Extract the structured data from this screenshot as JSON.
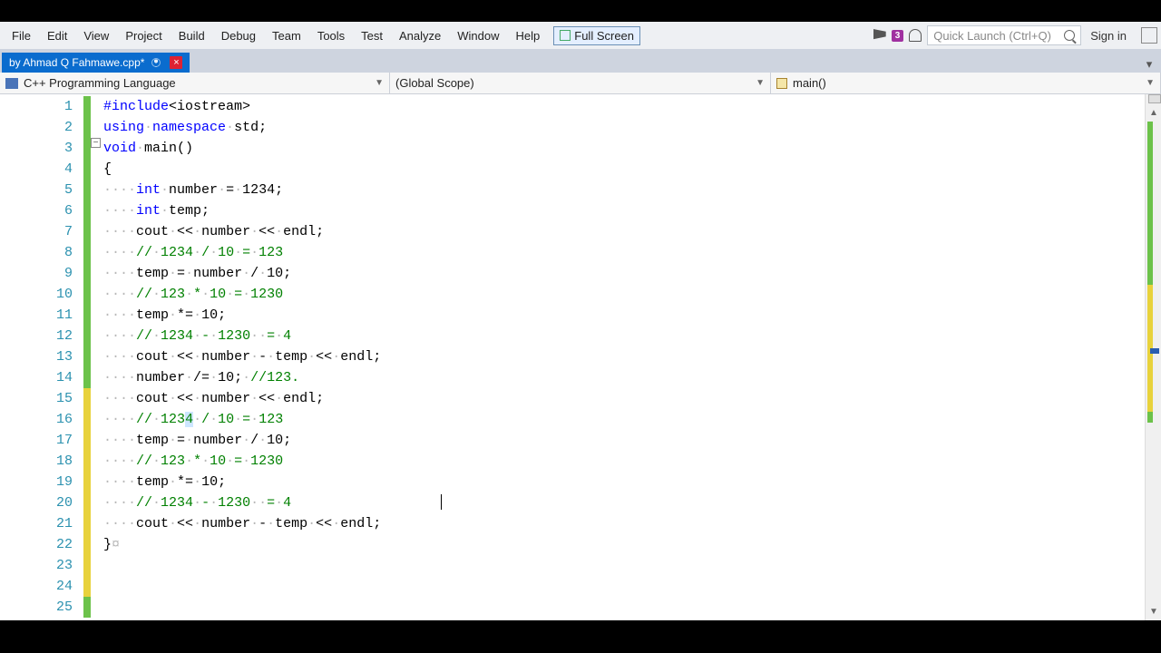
{
  "menu": {
    "items": [
      "File",
      "Edit",
      "View",
      "Project",
      "Build",
      "Debug",
      "Team",
      "Tools",
      "Test",
      "Analyze",
      "Window",
      "Help"
    ],
    "fullscreen": "Full Screen",
    "notif_count": "3",
    "search_placeholder": "Quick Launch (Ctrl+Q)",
    "signin": "Sign in"
  },
  "tab": {
    "title": "by Ahmad Q Fahmawe.cpp*"
  },
  "context": {
    "lang": "C++ Programming Language",
    "scope": "(Global Scope)",
    "func": "main()"
  },
  "code": {
    "lines": [
      {
        "n": "1",
        "bar": "green",
        "html": "<span class='kw'>#include</span>&lt;iostream&gt;"
      },
      {
        "n": "2",
        "bar": "green",
        "html": "<span class='kw'>using</span><span class='ws'>·</span><span class='kw'>namespace</span><span class='ws'>·</span>std;"
      },
      {
        "n": "3",
        "bar": "green",
        "html": "<span class='kw'>void</span><span class='ws'>·</span>main()"
      },
      {
        "n": "4",
        "bar": "green",
        "html": "{"
      },
      {
        "n": "5",
        "bar": "green",
        "html": ""
      },
      {
        "n": "6",
        "bar": "green",
        "html": "<span class='ws'>····</span><span class='kw'>int</span><span class='ws'>·</span>number<span class='ws'>·</span>=<span class='ws'>·</span>1234;"
      },
      {
        "n": "7",
        "bar": "green",
        "html": "<span class='ws'>····</span><span class='kw'>int</span><span class='ws'>·</span>temp;"
      },
      {
        "n": "8",
        "bar": "green",
        "html": "<span class='ws'>····</span>cout<span class='ws'>·</span>&lt;&lt;<span class='ws'>·</span>number<span class='ws'>·</span>&lt;&lt;<span class='ws'>·</span>endl;"
      },
      {
        "n": "9",
        "bar": "green",
        "html": "<span class='ws'>····</span><span class='cm'>//<span class='ws'>·</span>1234<span class='ws'>·</span>/<span class='ws'>·</span>10<span class='ws'>·</span>=<span class='ws'>·</span>123</span>"
      },
      {
        "n": "10",
        "bar": "green",
        "html": "<span class='ws'>····</span>temp<span class='ws'>·</span>=<span class='ws'>·</span>number<span class='ws'>·</span>/<span class='ws'>·</span>10;"
      },
      {
        "n": "11",
        "bar": "green",
        "html": "<span class='ws'>····</span><span class='cm'>//<span class='ws'>·</span>123<span class='ws'>·</span>*<span class='ws'>·</span>10<span class='ws'>·</span>=<span class='ws'>·</span>1230</span>"
      },
      {
        "n": "12",
        "bar": "green",
        "html": "<span class='ws'>····</span>temp<span class='ws'>·</span>*=<span class='ws'>·</span>10;"
      },
      {
        "n": "13",
        "bar": "green",
        "html": "<span class='ws'>····</span><span class='cm'>//<span class='ws'>·</span>1234<span class='ws'>·</span>-<span class='ws'>·</span>1230<span class='ws'>··</span>=<span class='ws'>·</span>4</span>"
      },
      {
        "n": "14",
        "bar": "green",
        "html": "<span class='ws'>····</span>cout<span class='ws'>·</span>&lt;&lt;<span class='ws'>·</span>number<span class='ws'>·</span>-<span class='ws'>·</span>temp<span class='ws'>·</span>&lt;&lt;<span class='ws'>·</span>endl;"
      },
      {
        "n": "15",
        "bar": "yellow",
        "html": "<span class='ws'>····</span>number<span class='ws'>·</span>/=<span class='ws'>·</span>10;<span class='ws'>·</span><span class='cm'>//123.</span>"
      },
      {
        "n": "16",
        "bar": "yellow",
        "html": "<span class='ws'>····</span>cout<span class='ws'>·</span>&lt;&lt;<span class='ws'>·</span>number<span class='ws'>·</span>&lt;&lt;<span class='ws'>·</span>endl;"
      },
      {
        "n": "17",
        "bar": "yellow",
        "html": "<span class='ws'>····</span><span class='cm'>//<span class='ws'>·</span>123<span class='hl'>4</span><span class='ws'>·</span>/<span class='ws'>·</span>10<span class='ws'>·</span>=<span class='ws'>·</span>123</span>"
      },
      {
        "n": "18",
        "bar": "yellow",
        "html": "<span class='ws'>····</span>temp<span class='ws'>·</span>=<span class='ws'>·</span>number<span class='ws'>·</span>/<span class='ws'>·</span>10;"
      },
      {
        "n": "19",
        "bar": "yellow",
        "html": "<span class='ws'>····</span><span class='cm'>//<span class='ws'>·</span>123<span class='ws'>·</span>*<span class='ws'>·</span>10<span class='ws'>·</span>=<span class='ws'>·</span>1230</span>"
      },
      {
        "n": "20",
        "bar": "yellow",
        "html": "<span class='ws'>····</span>temp<span class='ws'>·</span>*=<span class='ws'>·</span>10;"
      },
      {
        "n": "21",
        "bar": "yellow",
        "html": "<span class='ws'>····</span><span class='cm'>//<span class='ws'>·</span>1234<span class='ws'>·</span>-<span class='ws'>·</span>1230<span class='ws'>··</span>=<span class='ws'>·</span>4</span>"
      },
      {
        "n": "22",
        "bar": "yellow",
        "html": "<span class='ws'>····</span>cout<span class='ws'>·</span>&lt;&lt;<span class='ws'>·</span>number<span class='ws'>·</span>-<span class='ws'>·</span>temp<span class='ws'>·</span>&lt;&lt;<span class='ws'>·</span>endl;"
      },
      {
        "n": "23",
        "bar": "yellow",
        "html": ""
      },
      {
        "n": "24",
        "bar": "yellow",
        "html": ""
      },
      {
        "n": "25",
        "bar": "green",
        "html": "}<span class='ws'>¤</span>"
      }
    ]
  }
}
